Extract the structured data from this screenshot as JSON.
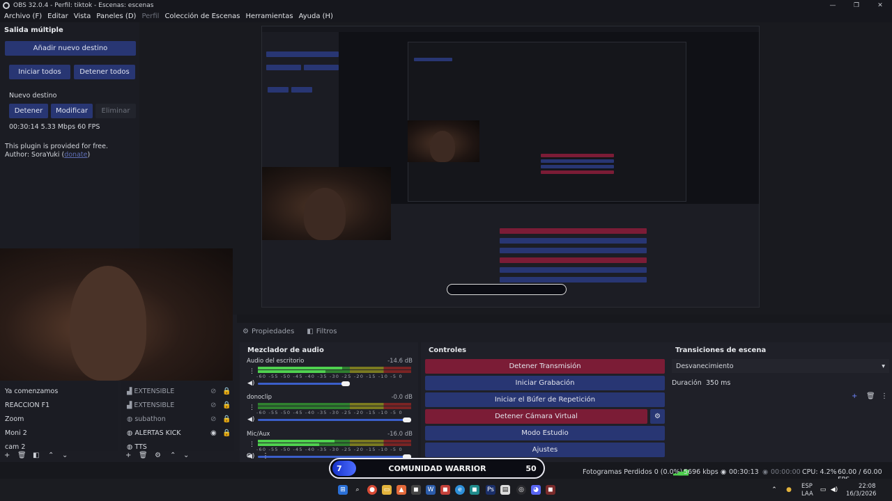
{
  "window": {
    "title": "OBS 32.0.4 - Perfil: tiktok - Escenas: escenas",
    "min": "—",
    "max": "❐",
    "close": "✕"
  },
  "menu": [
    "Archivo (F)",
    "Editar",
    "Vista",
    "Paneles (D)",
    "Perfil",
    "Colección de Escenas",
    "Herramientas",
    "Ayuda (H)"
  ],
  "multi_output": {
    "title": "Salida múltiple",
    "add_destination": "Añadir nuevo destino",
    "start_all": "Iniciar todos",
    "stop_all": "Detener todos",
    "destination_name": "Nuevo destino",
    "stop": "Detener",
    "modify": "Modificar",
    "remove": "Eliminar",
    "stats": "00:30:14  5.33 Mbps  60 FPS",
    "plugin_note": "This plugin is provided for free.",
    "author_prefix": "Author: SoraYuki (",
    "author_link": "donate",
    "author_suffix": ")"
  },
  "tabs": {
    "properties": "Propiedades",
    "filters": "Filtros"
  },
  "audio_mixer": {
    "title": "Mezclador de audio",
    "scale": "-60 -55 -50 -45 -40 -35 -30 -25 -20 -15 -10 -5 0",
    "tracks": [
      {
        "name": "Audio del escritorio",
        "db": "-14.6 dB",
        "level": 0.55,
        "volume": 0.6
      },
      {
        "name": "donoclip",
        "db": "-0.0 dB",
        "level": 0.0,
        "volume": 1.0
      },
      {
        "name": "Mic/Aux",
        "db": "-16.0 dB",
        "level": 0.5,
        "volume": 1.0
      }
    ]
  },
  "controls": {
    "title": "Controles",
    "stop_stream": "Detener Transmisión",
    "start_record": "Iniciar Grabación",
    "start_replay": "Iniciar el Búfer de Repetición",
    "stop_virtual_cam": "Detener Cámara Virtual",
    "studio_mode": "Modo Estudio",
    "settings": "Ajustes"
  },
  "transitions": {
    "title": "Transiciones de escena",
    "selected": "Desvanecimiento",
    "duration_label": "Duración",
    "duration_value": "350 ms"
  },
  "scenes": [
    "Ya comenzamos",
    "REACCION F1",
    "Zoom",
    "Moni 2",
    "cam 2"
  ],
  "sources": [
    "EXTENSIBLE",
    "EXTENSIBLE",
    "subathon",
    "ALERTAS KICK",
    "TTS"
  ],
  "overlay": {
    "number": "7",
    "text": "COMUNIDAD WARRIOR",
    "score": "50"
  },
  "status": {
    "dropped": "Fotogramas Perdidos 0 (0.0%)",
    "kbps": "5696 kbps",
    "stream_time": "00:30:13",
    "rec_time": "00:00:00",
    "cpu": "CPU: 4.2%",
    "fps": "60.00 / 60.00 FPS"
  },
  "tray": {
    "lang_top": "ESP",
    "lang_bottom": "LAA",
    "time": "22:08",
    "date": "16/3/2026"
  },
  "colors": {
    "blue": "#283673",
    "red": "#7b1c36"
  }
}
